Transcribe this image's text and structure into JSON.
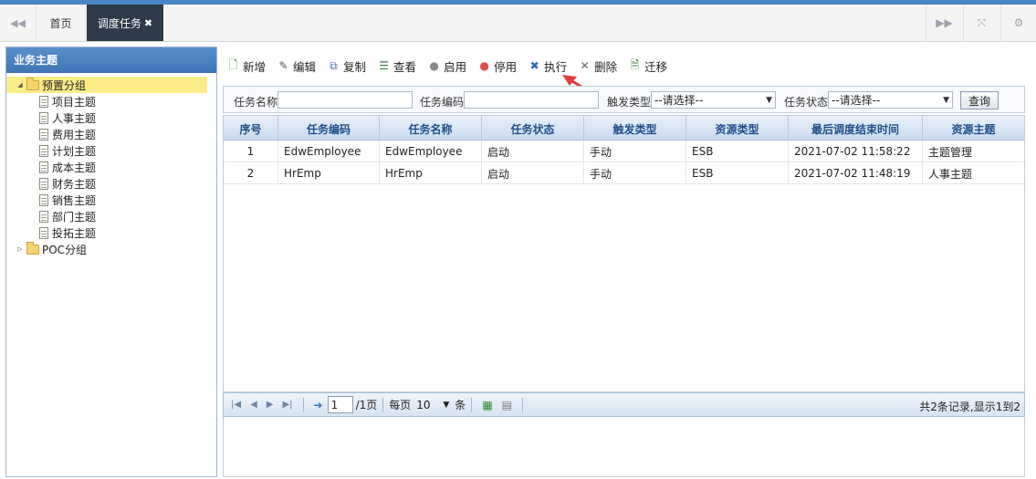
{
  "tabs": {
    "home": "首页",
    "active": "调度任务",
    "close_glyph": "✖"
  },
  "left": {
    "title": "业务主题",
    "groups": [
      {
        "label": "预置分组",
        "expanded": true,
        "children": [
          "项目主题",
          "人事主题",
          "费用主题",
          "计划主题",
          "成本主题",
          "财务主题",
          "销售主题",
          "部门主题",
          "投拓主题"
        ]
      },
      {
        "label": "POC分组",
        "expanded": false,
        "children": []
      }
    ]
  },
  "toolbar": {
    "add": "新增",
    "edit": "编辑",
    "copy": "复制",
    "view": "查看",
    "enable": "启用",
    "disable": "停用",
    "execute": "执行",
    "delete": "删除",
    "migrate": "迁移"
  },
  "search": {
    "task_name_label": "任务名称",
    "task_name_value": "",
    "task_code_label": "任务编码",
    "task_code_value": "",
    "trigger_type_label": "触发类型",
    "trigger_type_value": "--请选择--",
    "task_status_label": "任务状态",
    "task_status_value": "--请选择--",
    "query_button": "查询"
  },
  "table": {
    "columns": [
      "序号",
      "任务编码",
      "任务名称",
      "任务状态",
      "触发类型",
      "资源类型",
      "最后调度结束时间",
      "资源主题"
    ],
    "rows": [
      [
        "1",
        "EdwEmployee",
        "EdwEmployee",
        "启动",
        "手动",
        "ESB",
        "2021-07-02 11:58:22",
        "主题管理"
      ],
      [
        "2",
        "HrEmp",
        "HrEmp",
        "启动",
        "手动",
        "ESB",
        "2021-07-02 11:48:19",
        "人事主题"
      ]
    ]
  },
  "pager": {
    "current_page": "1",
    "total_pages": "/1页",
    "per_page_label": "每页",
    "per_page_value": "10",
    "per_page_suffix": "条",
    "summary": "共2条记录,显示1到2"
  },
  "colors": {
    "accent": "#4a86c5",
    "active_tab": "#2c3a4a",
    "selected_tree": "#fbec88",
    "arrow": "#e23b3b"
  }
}
